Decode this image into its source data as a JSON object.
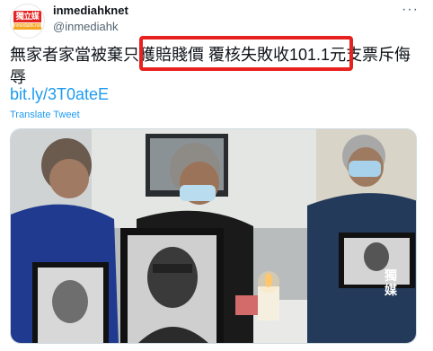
{
  "account": {
    "display_name": "inmediahknet",
    "handle": "@inmediahk",
    "logo_text_top": "獨立媒體",
    "logo_text_bottom": "inmediahk.net"
  },
  "tweet": {
    "text_before": "無家者家當被棄只",
    "text_highlight": "獲賠賤價 覆核失敗收",
    "highlight_number": "101.1",
    "highlight_unit": "元",
    "text_after": "支票斥侮辱",
    "link": "bit.ly/3T0ateE",
    "translate_label": "Translate Tweet",
    "more_icon": "more-dots-icon"
  },
  "photo": {
    "watermark": "獨媒",
    "description_icon": "tweet-photo"
  },
  "colors": {
    "highlight_border": "#e8201e",
    "link": "#1d9bf0",
    "secondary_text": "#536471"
  }
}
